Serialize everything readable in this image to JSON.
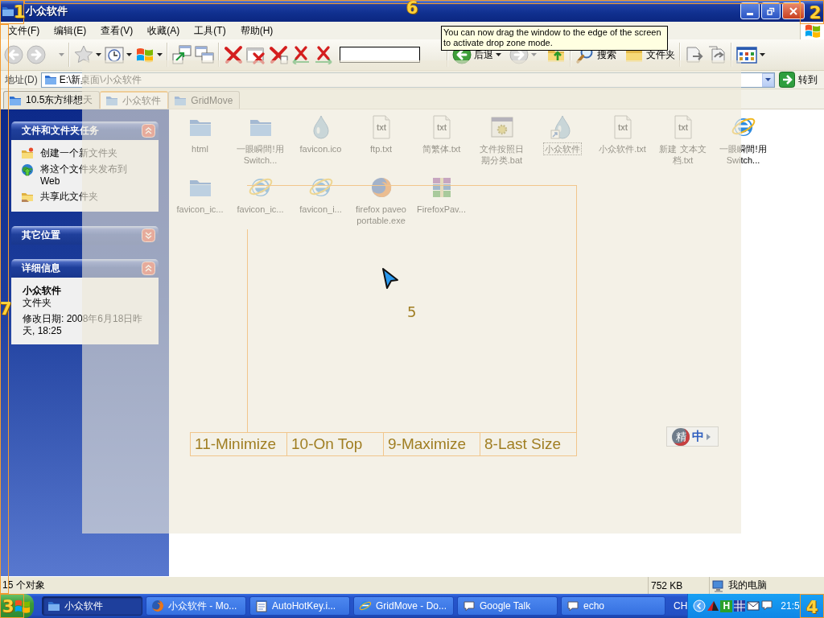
{
  "window": {
    "title": "小众软件"
  },
  "menu": [
    {
      "label": "文件(F)"
    },
    {
      "label": "编辑(E)"
    },
    {
      "label": "查看(V)"
    },
    {
      "label": "收藏(A)"
    },
    {
      "label": "工具(T)"
    },
    {
      "label": "帮助(H)"
    }
  ],
  "toolbar": {
    "nav_buttons": [
      {
        "disabled": true
      },
      {
        "disabled": true
      }
    ],
    "back": {
      "label": "后退",
      "disabled": false
    },
    "forward": {
      "disabled": true
    },
    "search": {
      "label": "搜索"
    },
    "folders": {
      "label": "文件夹"
    }
  },
  "tooltip": {
    "text": "You can now drag the window to the edge of the screen to activate drop zone mode."
  },
  "address": {
    "label": "地址(D)",
    "value": "E:\\新桌面\\小众软件",
    "go": "转到"
  },
  "tabs": [
    {
      "label": "10.5东方绯想天",
      "selected": false
    },
    {
      "label": "小众软件",
      "selected": true
    },
    {
      "label": "GridMove",
      "selected": false
    }
  ],
  "task_pane": {
    "panels": [
      {
        "kind": "tasks",
        "title": "文件和文件夹任务",
        "expanded": true,
        "items": [
          {
            "kind": "new_folder",
            "label": "创建一个新文件夹"
          },
          {
            "kind": "publish",
            "label": "将这个文件夹发布到 Web"
          },
          {
            "kind": "share",
            "label": "共享此文件夹"
          }
        ]
      },
      {
        "title": "其它位置",
        "expanded": false
      },
      {
        "kind": "details",
        "title": "详细信息",
        "expanded": true,
        "name": "小众软件",
        "type": "文件夹",
        "modified": "修改日期: 2008年6月18日昨天, 18:25"
      }
    ]
  },
  "files": [
    {
      "name": "html",
      "kind": "folder",
      "focused": false
    },
    {
      "name": "一眼瞬間!用Switch...",
      "kind": "folder",
      "focused": false
    },
    {
      "name": "favicon.ico",
      "kind": "drop",
      "focused": false
    },
    {
      "name": "ftp.txt",
      "kind": "txt",
      "icon_text": "txt",
      "focused": false
    },
    {
      "name": "简繁体.txt",
      "kind": "txt",
      "icon_text": "txt",
      "focused": false
    },
    {
      "name": "文件按照日期分类.bat",
      "kind": "bat",
      "focused": false
    },
    {
      "name": "小众软件",
      "kind": "shortcut",
      "focused": true
    },
    {
      "name": "小众软件.txt",
      "kind": "txt",
      "icon_text": "txt",
      "focused": false
    },
    {
      "name": "新建 文本文档.txt",
      "kind": "txt",
      "icon_text": "txt",
      "focused": false
    },
    {
      "name": "一眼瞬間!用Switch...",
      "kind": "ie",
      "focused": false
    },
    {
      "name": "favicon_ic...",
      "kind": "folder",
      "focused": false
    },
    {
      "name": "favicon_ic...",
      "kind": "ie",
      "focused": false
    },
    {
      "name": "favicon_i...",
      "kind": "ie",
      "focused": false
    },
    {
      "name": "firefox paveo portable.exe",
      "kind": "firefox",
      "focused": false
    },
    {
      "name": "FirefoxPav...",
      "kind": "archive",
      "focused": false
    }
  ],
  "status_bar": {
    "objects": "15 个对象",
    "size": "752 KB",
    "location": "我的电脑"
  },
  "taskbar": {
    "tasks": [
      {
        "label": "小众软件",
        "kind": "folder",
        "selected": true
      },
      {
        "label": "小众软件 - Mo...",
        "kind": "firefox",
        "selected": false
      },
      {
        "label": "AutoHotKey.i...",
        "kind": "notepad",
        "selected": false
      },
      {
        "label": "GridMove - Do...",
        "kind": "ie",
        "selected": false
      },
      {
        "label": "Google Talk",
        "kind": "chat",
        "selected": false
      },
      {
        "label": "echo",
        "kind": "chat",
        "selected": false
      }
    ],
    "language": "CH",
    "tray_badge": "H",
    "clock": "21:5"
  },
  "ime_bar": {
    "badge": "精",
    "mode": "中"
  },
  "gridmove": {
    "zones": [
      "1",
      "6",
      "2",
      "7",
      "5",
      "3",
      "4"
    ],
    "bottom_zones": [
      "11-Minimize",
      "10-On Top",
      "9-Maximize",
      "8-Last Size"
    ]
  }
}
